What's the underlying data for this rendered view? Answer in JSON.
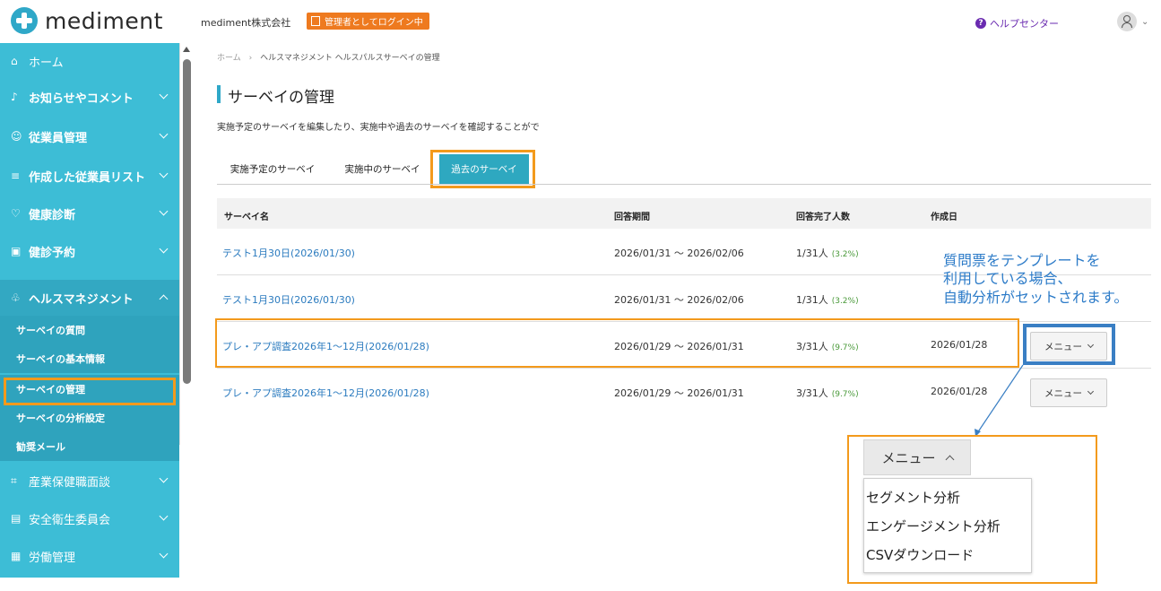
{
  "header": {
    "logo_text": "mediment",
    "company": "mediment株式会社",
    "admin_badge": "管理者としてログイン中",
    "help_center": "ヘルプセンター"
  },
  "sidebar": {
    "items": [
      {
        "label": "ホーム",
        "icon": "home-icon"
      },
      {
        "label": "お知らせやコメント",
        "icon": "bell-icon"
      },
      {
        "label": "従業員管理",
        "icon": "people-icon"
      },
      {
        "label": "作成した従業員リスト",
        "icon": "list-icon"
      },
      {
        "label": "健康診断",
        "icon": "stethoscope-icon"
      },
      {
        "label": "健診予約",
        "icon": "calendar-icon"
      },
      {
        "label": "ヘルスマネジメント",
        "icon": "health-icon"
      }
    ],
    "sub_items": [
      "サーベイの質問",
      "サーベイの基本情報",
      "サーベイの管理",
      "サーベイの分析設定",
      "勧奨メール"
    ],
    "bottom_items": [
      {
        "label": "産業保健職面談",
        "icon": "interview-icon"
      },
      {
        "label": "安全衛生委員会",
        "icon": "document-icon"
      },
      {
        "label": "労働管理",
        "icon": "labor-icon"
      }
    ]
  },
  "breadcrumb": {
    "home": "ホーム",
    "separator": "›",
    "current": "ヘルスマネジメント ヘルスパルスサーベイの管理"
  },
  "page": {
    "title": "サーベイの管理",
    "description": "実施予定のサーベイを編集したり、実施中や過去のサーベイを確認することがで"
  },
  "tabs": [
    "実施予定のサーベイ",
    "実施中のサーベイ",
    "過去のサーベイ"
  ],
  "table": {
    "headers": [
      "サーベイ名",
      "回答期間",
      "回答完了人数",
      "作成日"
    ],
    "rows": [
      {
        "name": "テスト1月30日(2026/01/30)",
        "period": "2026/01/31 ～ 2026/02/06",
        "count": "1/31人",
        "pct": "(3.2%)",
        "created": "",
        "menu": ""
      },
      {
        "name": "テスト1月30日(2026/01/30)",
        "period": "2026/01/31 ～ 2026/02/06",
        "count": "1/31人",
        "pct": "(3.2%)",
        "created": "",
        "menu": ""
      },
      {
        "name": "プレ・アプ調査2026年1～12月(2026/01/28)",
        "period": "2026/01/29 ～ 2026/01/31",
        "count": "3/31人",
        "pct": "(9.7%)",
        "created": "2026/01/28",
        "menu": "メニュー"
      },
      {
        "name": "プレ・アプ調査2026年1～12月(2026/01/28)",
        "period": "2026/01/29 ～ 2026/01/31",
        "count": "3/31人",
        "pct": "(9.7%)",
        "created": "2026/01/28",
        "menu": "メニュー"
      }
    ]
  },
  "note": {
    "line1": "質問票をテンプレートを",
    "line2": "利用している場合、",
    "line3": "自動分析がセットされます。"
  },
  "zoom": {
    "button": "メニュー",
    "items": [
      "セグメント分析",
      "エンゲージメント分析",
      "CSVダウンロード"
    ]
  },
  "colors": {
    "sidebar": "#3dbdd6",
    "accent_orange": "#f39a1c",
    "highlight_blue": "#3a7fc4",
    "link": "#2b7bbf",
    "tab_active": "#2ea8c0"
  }
}
